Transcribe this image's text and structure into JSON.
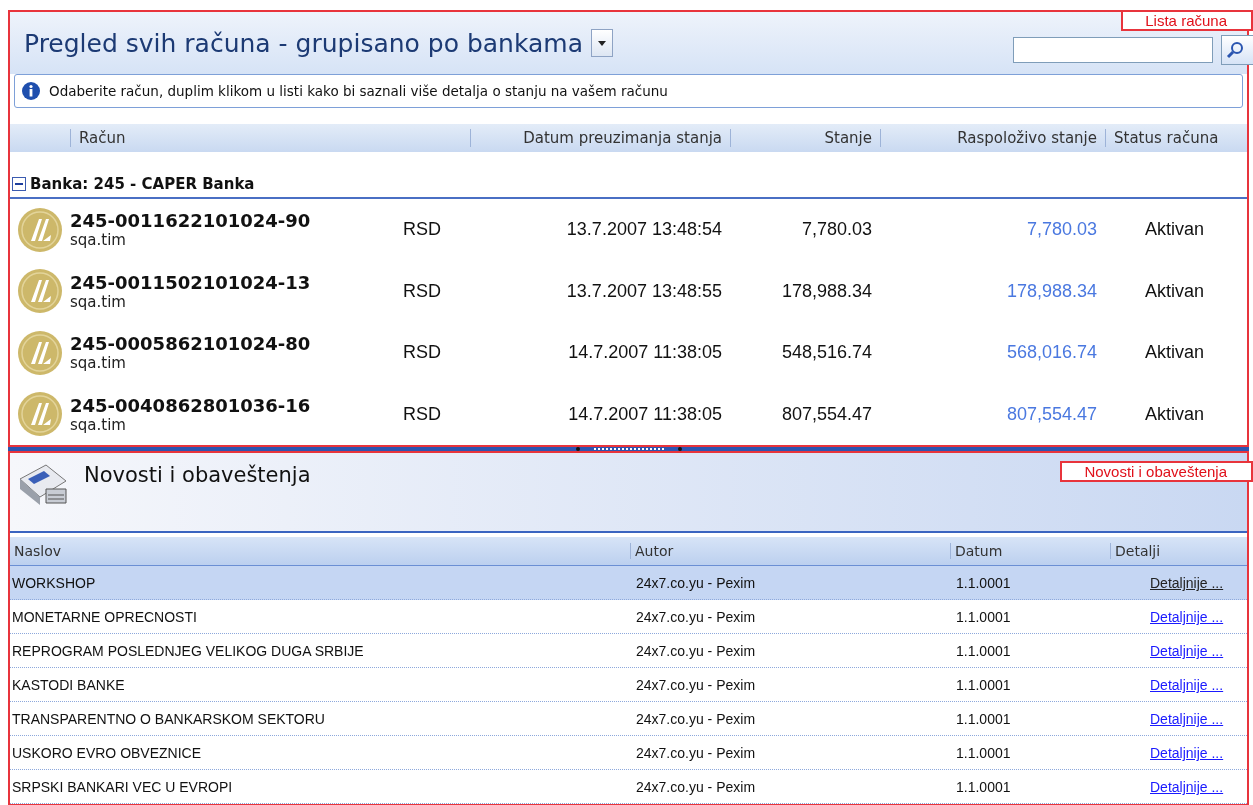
{
  "accounts_panel": {
    "annotation": "Lista računa",
    "title": "Pregled svih računa - grupisano po bankama",
    "info": "Odaberite račun, duplim klikom u listi kako bi saznali više detalja o stanju na vašem računu",
    "columns": [
      "Račun",
      "Datum preuzimanja stanja",
      "Stanje",
      "Raspoloživo stanje",
      "Status računa"
    ],
    "group": {
      "label": "Banka:  245 - CAPER Banka",
      "expanded": true
    },
    "rows": [
      {
        "account": "245-0011622101024-90",
        "owner": "sqa.tim",
        "currency": "RSD",
        "date": "13.7.2007 13:48:54",
        "balance": "7,780.03",
        "available": "7,780.03",
        "status": "Aktivan"
      },
      {
        "account": "245-0011502101024-13",
        "owner": "sqa.tim",
        "currency": "RSD",
        "date": "13.7.2007 13:48:55",
        "balance": "178,988.34",
        "available": "178,988.34",
        "status": "Aktivan"
      },
      {
        "account": "245-0005862101024-80",
        "owner": "sqa.tim",
        "currency": "RSD",
        "date": "14.7.2007 11:38:05",
        "balance": "548,516.74",
        "available": "568,016.74",
        "status": "Aktivan"
      },
      {
        "account": "245-0040862801036-16",
        "owner": "sqa.tim",
        "currency": "RSD",
        "date": "14.7.2007 11:38:05",
        "balance": "807,554.47",
        "available": "807,554.47",
        "status": "Aktivan"
      }
    ]
  },
  "news_panel": {
    "annotation": "Novosti i obaveštenja",
    "title": "Novosti i obaveštenja",
    "columns": [
      "Naslov",
      "Autor",
      "Datum",
      "Detalji"
    ],
    "rows": [
      {
        "title": "WORKSHOP",
        "author": "24x7.co.yu - Pexim",
        "date": "1.1.0001",
        "link": "Detaljnije ...",
        "selected": true
      },
      {
        "title": "MONETARNE OPRECNOSTI",
        "author": "24x7.co.yu - Pexim",
        "date": "1.1.0001",
        "link": "Detaljnije ...",
        "selected": false
      },
      {
        "title": "REPROGRAM POSLEDNJEG VELIKOG DUGA SRBIJE",
        "author": "24x7.co.yu - Pexim",
        "date": "1.1.0001",
        "link": "Detaljnije ...",
        "selected": false
      },
      {
        "title": "KASTODI BANKE",
        "author": "24x7.co.yu - Pexim",
        "date": "1.1.0001",
        "link": "Detaljnije ...",
        "selected": false
      },
      {
        "title": "TRANSPARENTNO O BANKARSKOM SEKTORU",
        "author": "24x7.co.yu - Pexim",
        "date": "1.1.0001",
        "link": "Detaljnije ...",
        "selected": false
      },
      {
        "title": "USKORO EVRO OBVEZNICE",
        "author": "24x7.co.yu - Pexim",
        "date": "1.1.0001",
        "link": "Detaljnije ...",
        "selected": false
      },
      {
        "title": "SRPSKI BANKARI VEC U EVROPI",
        "author": "24x7.co.yu - Pexim",
        "date": "1.1.0001",
        "link": "Detaljnije ...",
        "selected": false
      }
    ]
  }
}
